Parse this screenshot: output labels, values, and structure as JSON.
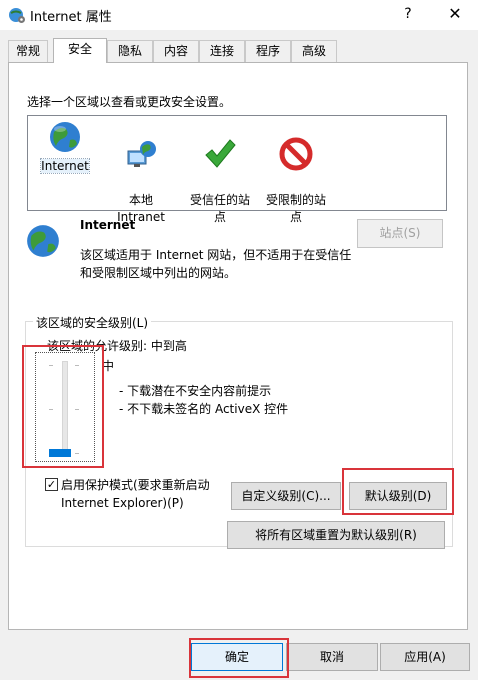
{
  "window": {
    "title": "Internet 属性",
    "help_glyph": "?",
    "close_glyph": "✕"
  },
  "tabs": [
    "常规",
    "安全",
    "隐私",
    "内容",
    "连接",
    "程序",
    "高级"
  ],
  "active_tab": "安全",
  "security": {
    "zone_prompt": "选择一个区域以查看或更改安全设置。",
    "zones": [
      {
        "label": "Internet",
        "icon": "globe-icon"
      },
      {
        "label": "本地\nIntranet",
        "icon": "intranet-icon"
      },
      {
        "label": "受信任的站\n点",
        "icon": "check-icon"
      },
      {
        "label": "受限制的站\n点",
        "icon": "restricted-icon"
      }
    ],
    "selected_zone": {
      "name": "Internet",
      "description": "该区域适用于 Internet 网站，但不适用于在受信任和受限制区域中列出的网站。"
    },
    "sites_button": "站点(S)",
    "level_group_label": "该区域的安全级别(L)",
    "allowed_levels": "该区域的允许级别: 中到高",
    "level_name": "中",
    "level_bullets": [
      "- 下载潜在不安全内容前提示",
      "- 不下载未签名的 ActiveX 控件"
    ],
    "slider_level_fraction": 0.0,
    "protected_mode_label": "启用保护模式(要求重新启动\nInternet Explorer)(P)",
    "protected_mode_checked": "✓",
    "custom_level_button": "自定义级别(C)...",
    "default_level_button": "默认级别(D)",
    "reset_all_button": "将所有区域重置为默认级别(R)"
  },
  "footer": {
    "ok": "确定",
    "cancel": "取消",
    "apply": "应用(A)"
  },
  "colors": {
    "accent": "#0078d7",
    "highlight": "#d9343a"
  }
}
